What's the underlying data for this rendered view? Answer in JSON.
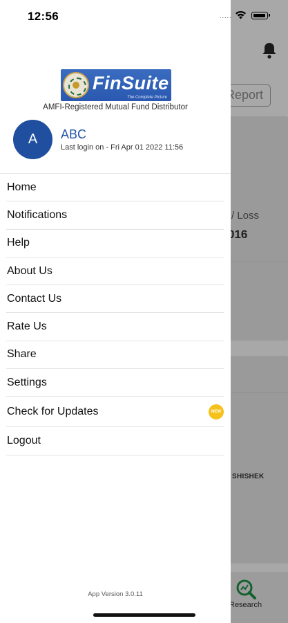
{
  "status_bar": {
    "time": "12:56",
    "dots": "....."
  },
  "background": {
    "report_button": "Report",
    "loss_label": "/ Loss",
    "loss_value": "016",
    "name_fragment": "SHISHEK",
    "research_label": "Research",
    "icons": [
      "bell-icon",
      "research-icon"
    ]
  },
  "drawer": {
    "logo": {
      "brand": "FinSuite",
      "tagline_small": "The Complete Picture"
    },
    "tagline": "AMFI-Registered Mutual Fund Distributor",
    "user": {
      "initial": "A",
      "name": "ABC",
      "last_login": "Last login on - Fri Apr 01 2022 11:56"
    },
    "menu": [
      {
        "label": "Home"
      },
      {
        "label": "Notifications"
      },
      {
        "label": "Help"
      },
      {
        "label": "About Us"
      },
      {
        "label": "Contact Us"
      },
      {
        "label": "Rate Us"
      },
      {
        "label": "Share"
      },
      {
        "label": "Settings"
      },
      {
        "label": "Check for Updates",
        "badge": "NEW"
      },
      {
        "label": "Logout"
      }
    ],
    "app_version": "App Version 3.0.11"
  },
  "colors": {
    "accent": "#1f4f9e",
    "badge": "#f4c21a",
    "overlay": "#a8a8a8"
  }
}
